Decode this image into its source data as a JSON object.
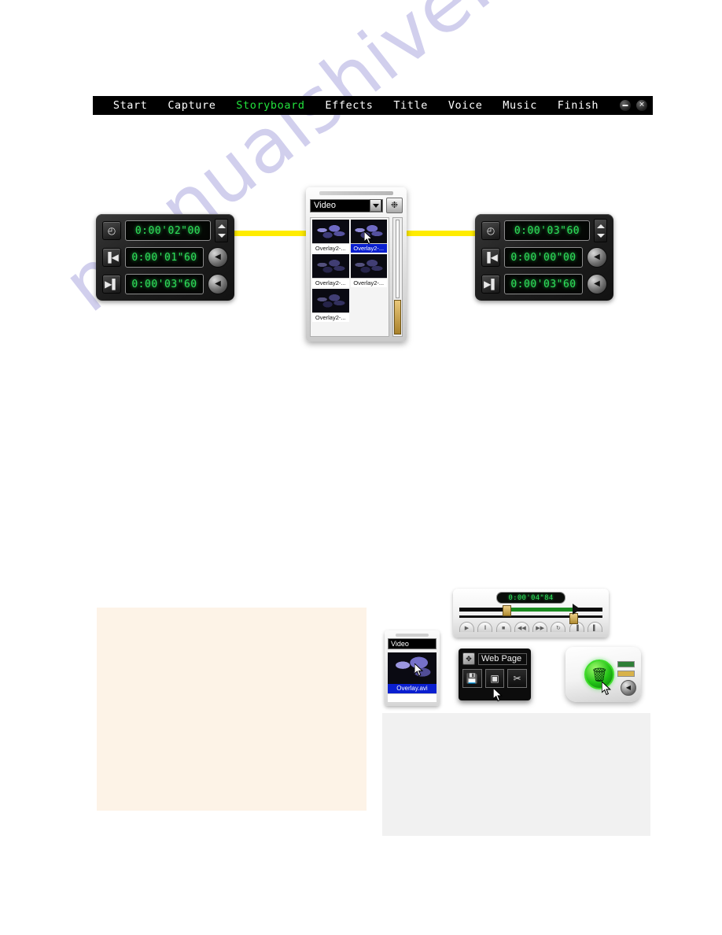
{
  "watermark": {
    "text": "manualshive.com"
  },
  "navbar": {
    "items": [
      {
        "label": "Start",
        "active": false
      },
      {
        "label": "Capture",
        "active": false
      },
      {
        "label": "Storyboard",
        "active": true
      },
      {
        "label": "Effects",
        "active": false
      },
      {
        "label": "Title",
        "active": false
      },
      {
        "label": "Voice",
        "active": false
      },
      {
        "label": "Music",
        "active": false
      },
      {
        "label": "Finish",
        "active": false
      }
    ],
    "minimize_icon": "minimize-icon",
    "close_icon": "close-icon",
    "active_color": "#22e23c",
    "background_color": "#000000"
  },
  "left_panel": {
    "rows": [
      {
        "icon": "clock-icon",
        "glyph": "◴",
        "value": "0:00'02\"00",
        "control": "spinner"
      },
      {
        "icon": "mark-in-icon",
        "glyph": "▐◀",
        "value": "0:00'01\"60",
        "control": "knob"
      },
      {
        "icon": "mark-out-icon",
        "glyph": "▶▌",
        "value": "0:00'03\"60",
        "control": "knob"
      }
    ],
    "knob_glyph": "◀",
    "display_color": "#2ee05a"
  },
  "right_panel": {
    "rows": [
      {
        "icon": "clock-icon",
        "glyph": "◴",
        "value": "0:00'03\"60",
        "control": "spinner"
      },
      {
        "icon": "mark-in-icon",
        "glyph": "▐◀",
        "value": "0:00'00\"00",
        "control": "knob"
      },
      {
        "icon": "mark-out-icon",
        "glyph": "▶▌",
        "value": "0:00'03\"60",
        "control": "knob"
      }
    ],
    "knob_glyph": "◀",
    "display_color": "#2ee05a"
  },
  "callout": {
    "line_color": "#ffec00"
  },
  "library": {
    "filter_value": "Video",
    "dropdown_icon": "chevron-down-icon",
    "reel_icon": "film-reel-icon",
    "reel_glyph": "❉",
    "thumbnails": [
      {
        "label": "Overlay2-...",
        "selected": false
      },
      {
        "label": "Overlay2-...",
        "selected": true
      },
      {
        "label": "Overlay2-...",
        "selected": false
      },
      {
        "label": "Overlay2-...",
        "selected": false
      },
      {
        "label": "Overlay2-...",
        "selected": false
      }
    ],
    "selected_color": "#0a1fd0",
    "cursor_icon": "mouse-cursor-icon"
  },
  "scrubber": {
    "timecode": "0:00'04\"84",
    "selection_color": "#1a8a1f",
    "handle_in_icon": "trim-in-handle",
    "handle_out_icon": "trim-out-handle",
    "playhead_icon": "playhead-icon",
    "buttons": [
      {
        "name": "play-button",
        "glyph": "▶"
      },
      {
        "name": "pause-button",
        "glyph": "‖"
      },
      {
        "name": "stop-button",
        "glyph": "■"
      },
      {
        "name": "prev-frame-button",
        "glyph": "◀◀"
      },
      {
        "name": "next-frame-button",
        "glyph": "▶▶"
      },
      {
        "name": "loop-button",
        "glyph": "↻"
      },
      {
        "name": "mark-in-button",
        "glyph": "▐"
      },
      {
        "name": "mark-out-button",
        "glyph": "▌"
      }
    ]
  },
  "mini_library": {
    "filter_value": "Video",
    "clip_label": "Overlay.avi",
    "selected_color": "#0a1fd0",
    "cursor_icon": "mouse-cursor-icon"
  },
  "webpage_dialog": {
    "title": "Web Page",
    "move_icon": "move-handle-icon",
    "move_glyph": "✥",
    "buttons": [
      {
        "name": "save-button",
        "glyph": "💾"
      },
      {
        "name": "frame-button",
        "glyph": "▣"
      },
      {
        "name": "cut-button",
        "glyph": "✂"
      }
    ],
    "cursor_icon": "mouse-cursor-icon"
  },
  "recycle_widget": {
    "button_icon": "recycle-bin-icon",
    "button_glyph": "🗑",
    "button_color": "#22c216",
    "status_bars": [
      {
        "name": "status-bar-green",
        "color": "#2f7f37"
      },
      {
        "name": "status-bar-amber",
        "color": "#d8b24a"
      }
    ],
    "knob_glyph": "◀",
    "cursor_icon": "mouse-cursor-icon"
  }
}
